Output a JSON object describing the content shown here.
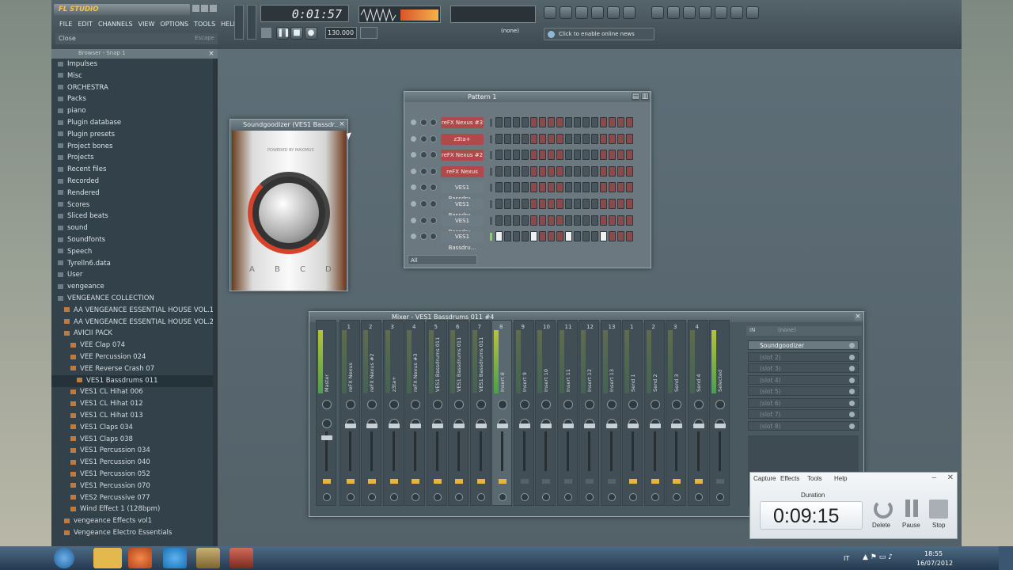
{
  "app": {
    "logo_text": "FL STUDIO",
    "time": "0:01:57",
    "menu": [
      "FILE",
      "EDIT",
      "CHANNELS",
      "VIEW",
      "OPTIONS",
      "TOOLS",
      "HELP"
    ],
    "hint": "Close",
    "hint_key": "Escape",
    "online_news": "Click to enable online news",
    "pattern_label": "(none)",
    "tempo_display": "130.000"
  },
  "browser": {
    "title": "Browser - Snap 1",
    "items": [
      {
        "label": "Impulses",
        "indent": 0
      },
      {
        "label": "Misc",
        "indent": 0
      },
      {
        "label": "ORCHESTRA",
        "indent": 0
      },
      {
        "label": "Packs",
        "indent": 0
      },
      {
        "label": "piano",
        "indent": 0
      },
      {
        "label": "Plugin database",
        "indent": 0
      },
      {
        "label": "Plugin presets",
        "indent": 0
      },
      {
        "label": "Project bones",
        "indent": 0
      },
      {
        "label": "Projects",
        "indent": 0
      },
      {
        "label": "Recent files",
        "indent": 0
      },
      {
        "label": "Recorded",
        "indent": 0
      },
      {
        "label": "Rendered",
        "indent": 0
      },
      {
        "label": "Scores",
        "indent": 0
      },
      {
        "label": "Sliced beats",
        "indent": 0
      },
      {
        "label": "sound",
        "indent": 0
      },
      {
        "label": "Soundfonts",
        "indent": 0
      },
      {
        "label": "Speech",
        "indent": 0
      },
      {
        "label": "Tyrelln6.data",
        "indent": 0
      },
      {
        "label": "User",
        "indent": 0
      },
      {
        "label": "vengeance",
        "indent": 0
      },
      {
        "label": "VENGEANCE COLLECTION",
        "indent": 0
      },
      {
        "label": "AA VENGEANCE ESSENTIAL HOUSE VOL.1",
        "indent": 1
      },
      {
        "label": "AA VENGEANCE ESSENTIAL HOUSE VOL.2",
        "indent": 1
      },
      {
        "label": "AVICII PACK",
        "indent": 1
      },
      {
        "label": "VEE Clap 074",
        "indent": 2
      },
      {
        "label": "VEE Percussion 024",
        "indent": 2
      },
      {
        "label": "VEE Reverse Crash 07",
        "indent": 2
      },
      {
        "label": "VES1 Bassdrums 011",
        "indent": 3,
        "selected": true
      },
      {
        "label": "VES1 CL Hihat 006",
        "indent": 2
      },
      {
        "label": "VES1 CL Hihat 012",
        "indent": 2
      },
      {
        "label": "VES1 CL Hihat 013",
        "indent": 2
      },
      {
        "label": "VES1 Claps 034",
        "indent": 2
      },
      {
        "label": "VES1 Claps 038",
        "indent": 2
      },
      {
        "label": "VES1 Percussion 034",
        "indent": 2
      },
      {
        "label": "VES1 Percussion 040",
        "indent": 2
      },
      {
        "label": "VES1 Percussion 052",
        "indent": 2
      },
      {
        "label": "VES1 Percussion 070",
        "indent": 2
      },
      {
        "label": "VES2 Percussive 077",
        "indent": 2
      },
      {
        "label": "Wind Effect 1 (128bpm)",
        "indent": 2
      },
      {
        "label": "vengeance Effects vol1",
        "indent": 1
      },
      {
        "label": "Vengeance Electro Essentials",
        "indent": 1
      }
    ]
  },
  "plugin": {
    "title": "Soundgoodizer (VES1 Bassdr...",
    "brand": "POWERED BY MAXIMUS",
    "modes": [
      "A",
      "B",
      "C",
      "D"
    ]
  },
  "step_sequencer": {
    "title": "Pattern 1",
    "filter": "All",
    "channels": [
      {
        "name": "reFX Nexus #3",
        "color": "#b04a4a"
      },
      {
        "name": "z3ta+",
        "color": "#b04a4a"
      },
      {
        "name": "reFX Nexus #2",
        "color": "#b04a4a"
      },
      {
        "name": "reFX Nexus",
        "color": "#b04a4a"
      },
      {
        "name": "VES1 Bassdru...",
        "color": "#6d7c84"
      },
      {
        "name": "VES1 Bassdru...",
        "color": "#6d7c84"
      },
      {
        "name": "VES1 Bassdru...",
        "color": "#6d7c84"
      },
      {
        "name": "VES1 Bassdru...",
        "color": "#6d7c84"
      }
    ],
    "active_steps_last_row": [
      0,
      4,
      8,
      12
    ]
  },
  "mixer": {
    "title": "Mixer - VES1 Bassdrums 011 #4",
    "strips": [
      "Master",
      "reFX Nexus",
      "reFX Nexus #2",
      "z3ta+",
      "reFX Nexus #3",
      "VES1 Bassdrums 011",
      "VES1 Bassdrums 011",
      "VES1 Bassdrums 011",
      "Insert 8",
      "Insert 9",
      "Insert 10",
      "Insert 11",
      "Insert 12",
      "Insert 13",
      "Send 1",
      "Send 2",
      "Send 3",
      "Send 4",
      "Selected"
    ],
    "numbers": [
      "",
      "1",
      "2",
      "3",
      "4",
      "5",
      "6",
      "7",
      "8",
      "9",
      "10",
      "11",
      "12",
      "13",
      "1",
      "2",
      "3",
      "4",
      ""
    ],
    "active_strip": 8,
    "fx_slots": [
      "Soundgoodizer",
      "(slot 2)",
      "(slot 3)",
      "(slot 4)",
      "(slot 5)",
      "(slot 6)",
      "(slot 7)",
      "(slot 8)"
    ],
    "in_label": "IN",
    "out_label": "(none)"
  },
  "recorder": {
    "menu": [
      "Capture",
      "Effects",
      "Tools",
      "Help"
    ],
    "duration_label": "Duration",
    "duration": "0:09:15",
    "buttons": [
      "Delete",
      "Pause",
      "Stop"
    ]
  },
  "taskbar": {
    "lang": "IT",
    "time": "18:55",
    "date": "16/07/2012"
  }
}
